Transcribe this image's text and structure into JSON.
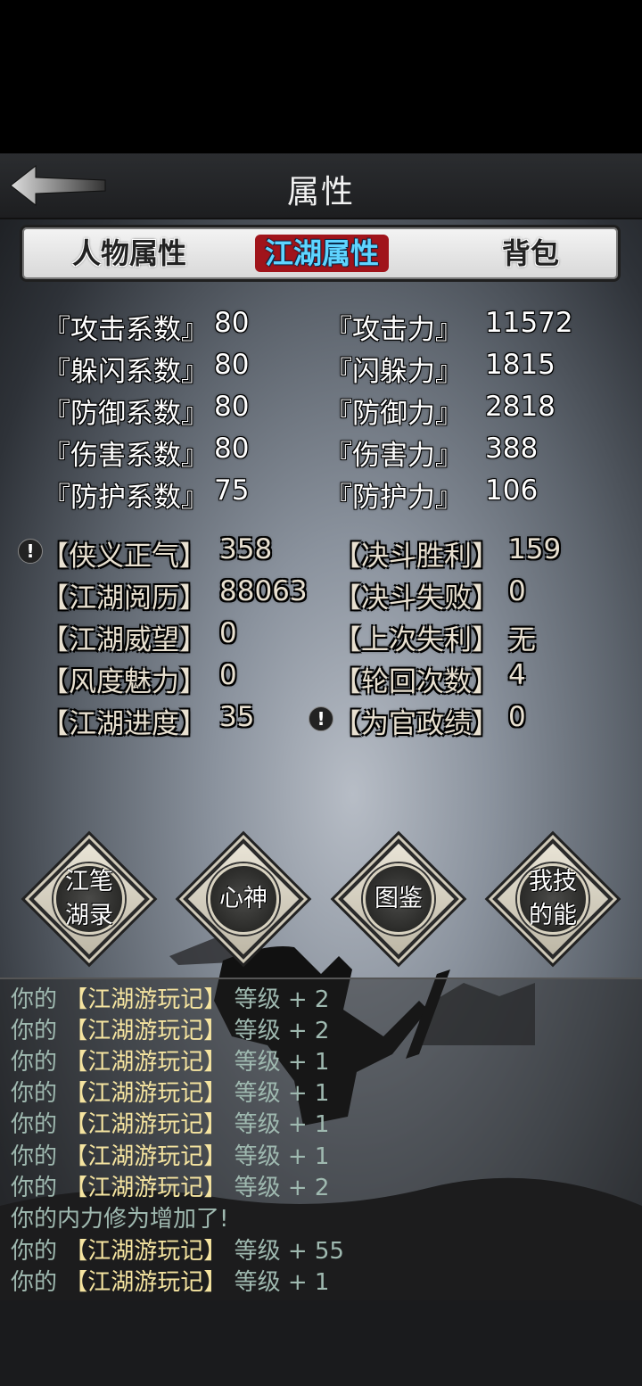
{
  "header": {
    "title": "属性"
  },
  "tabs": [
    {
      "label": "人物属性",
      "active": false
    },
    {
      "label": "江湖属性",
      "active": true
    },
    {
      "label": "背包",
      "active": false
    }
  ],
  "combat_stats": [
    {
      "label": "『攻击系数』",
      "value": "80",
      "label2": "『攻击力』",
      "value2": "11572"
    },
    {
      "label": "『躲闪系数』",
      "value": "80",
      "label2": "『闪躲力』",
      "value2": "1815"
    },
    {
      "label": "『防御系数』",
      "value": "80",
      "label2": "『防御力』",
      "value2": "2818"
    },
    {
      "label": "『伤害系数』",
      "value": "80",
      "label2": "『伤害力』",
      "value2": "388"
    },
    {
      "label": "『防护系数』",
      "value": "75",
      "label2": "『防护力』",
      "value2": "106"
    }
  ],
  "jianghu_stats": [
    {
      "label": "【侠义正气】",
      "value": "358",
      "label2": "【决斗胜利】",
      "value2": "159"
    },
    {
      "label": "【江湖阅历】",
      "value": "88063",
      "label2": "【决斗失败】",
      "value2": "0"
    },
    {
      "label": "【江湖威望】",
      "value": "0",
      "label2": "【上次失利】",
      "value2": "无"
    },
    {
      "label": "【风度魅力】",
      "value": "0",
      "label2": "【轮回次数】",
      "value2": "4"
    },
    {
      "label": "【江湖进度】",
      "value": "35",
      "label2": "【为官政绩】",
      "value2": "0"
    }
  ],
  "alert_icon_glyph": "!",
  "buttons": [
    {
      "line1": "江笔",
      "line2": "湖录"
    },
    {
      "line1": "心神",
      "line2": ""
    },
    {
      "line1": "图鉴",
      "line2": ""
    },
    {
      "line1": "我技",
      "line2": "的能"
    }
  ],
  "log": [
    {
      "prefix": "你的",
      "item": "【江湖游玩记】",
      "suffix": "等级 + 2"
    },
    {
      "prefix": "你的",
      "item": "【江湖游玩记】",
      "suffix": "等级 + 2"
    },
    {
      "prefix": "你的",
      "item": "【江湖游玩记】",
      "suffix": "等级 + 1"
    },
    {
      "prefix": "你的",
      "item": "【江湖游玩记】",
      "suffix": "等级 + 1"
    },
    {
      "prefix": "你的",
      "item": "【江湖游玩记】",
      "suffix": "等级 + 1"
    },
    {
      "prefix": "你的",
      "item": "【江湖游玩记】",
      "suffix": "等级 + 1"
    },
    {
      "prefix": "你的",
      "item": "【江湖游玩记】",
      "suffix": "等级 + 2"
    },
    {
      "prefix": "你的内力修为增加了!",
      "item": "",
      "suffix": ""
    },
    {
      "prefix": "你的",
      "item": "【江湖游玩记】",
      "suffix": "等级 + 55"
    },
    {
      "prefix": "你的",
      "item": "【江湖游玩记】",
      "suffix": "等级 + 1"
    }
  ],
  "colors": {
    "active_tab_bg": "#a0141b",
    "active_tab_text": "#5fd4ff",
    "log_item": "#f5e4a0",
    "log_text": "#9fb9b0"
  }
}
